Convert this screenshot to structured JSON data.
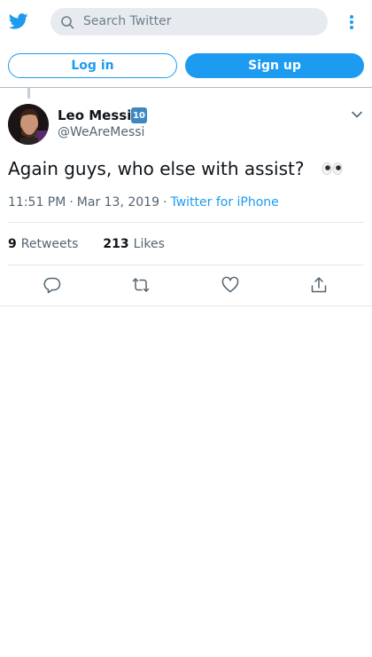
{
  "colors": {
    "brand": "#1d9bf0",
    "text": "#0f1419",
    "muted": "#536471",
    "search_bg": "#e7ebef"
  },
  "header": {
    "logo_icon": "twitter-bird-icon",
    "search_placeholder": "Search Twitter",
    "search_icon": "search-icon",
    "more_icon": "vertical-dots-icon"
  },
  "auth": {
    "login_label": "Log in",
    "signup_label": "Sign up"
  },
  "tweet": {
    "author_name": "Leo Messi",
    "author_badge": "10",
    "author_handle": "@WeAreMessi",
    "text": "Again guys, who else with assist?",
    "emoji": "👀",
    "time": "11:51 PM",
    "separator": "·",
    "date": "Mar 13, 2019",
    "source": "Twitter for iPhone",
    "retweets_count": "9",
    "retweets_label": "Retweets",
    "likes_count": "213",
    "likes_label": "Likes"
  },
  "actions": {
    "reply_icon": "reply-icon",
    "retweet_icon": "retweet-icon",
    "like_icon": "like-icon",
    "share_icon": "share-icon"
  }
}
